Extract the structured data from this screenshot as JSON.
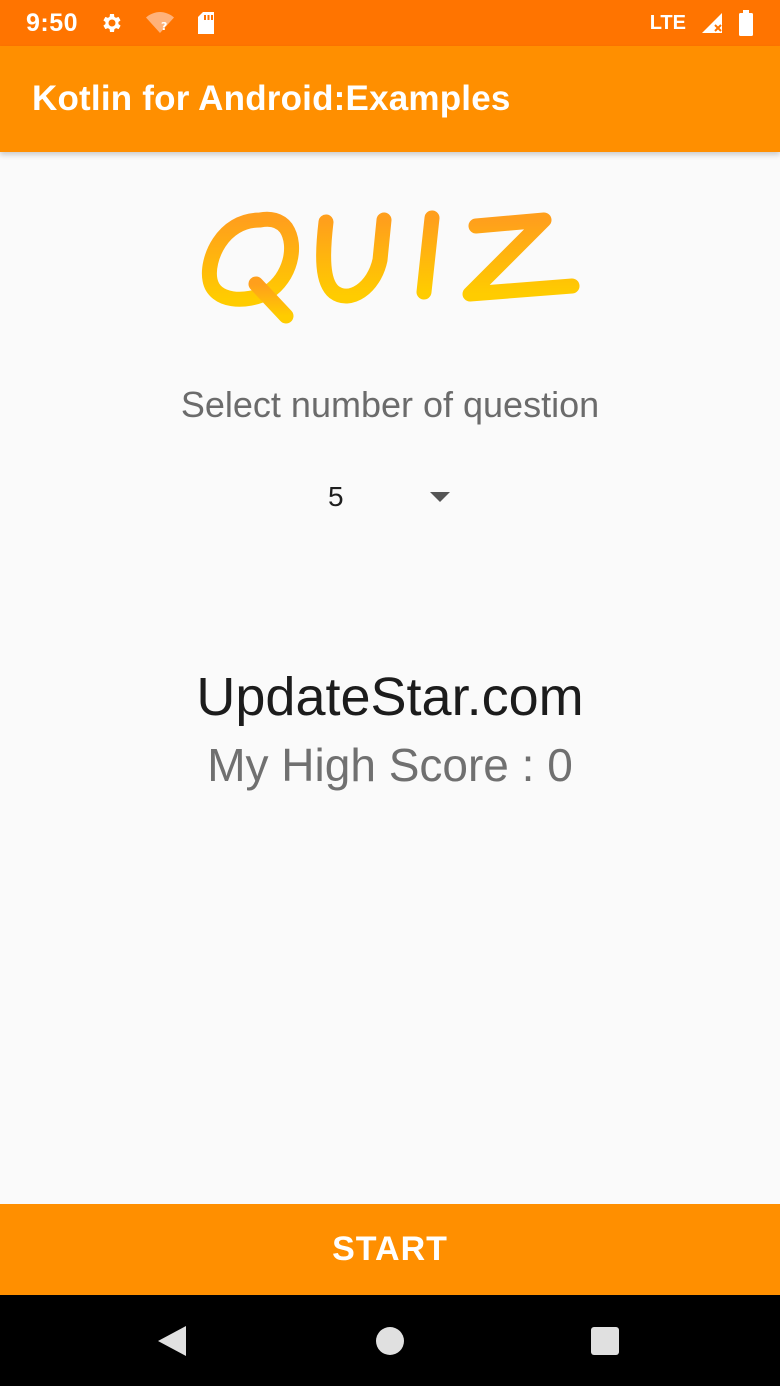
{
  "status_bar": {
    "time": "9:50",
    "network": "LTE",
    "icons": [
      "gear-icon",
      "wifi-question-icon",
      "sd-card-icon",
      "signal-icon",
      "battery-icon"
    ]
  },
  "app_bar": {
    "title": "Kotlin for Android:Examples",
    "color": "#ff8f00"
  },
  "logo": {
    "text": "QUIZ",
    "color_top": "#ff9f1c",
    "color_bottom": "#ffcc00"
  },
  "prompt": "Select number of question",
  "spinner": {
    "selected": "5"
  },
  "brand": "UpdateStar.com",
  "high_score": "My High Score : 0",
  "start_button": {
    "label": "START"
  },
  "nav_bar": {
    "icons": [
      "back-icon",
      "home-icon",
      "recents-icon"
    ]
  }
}
